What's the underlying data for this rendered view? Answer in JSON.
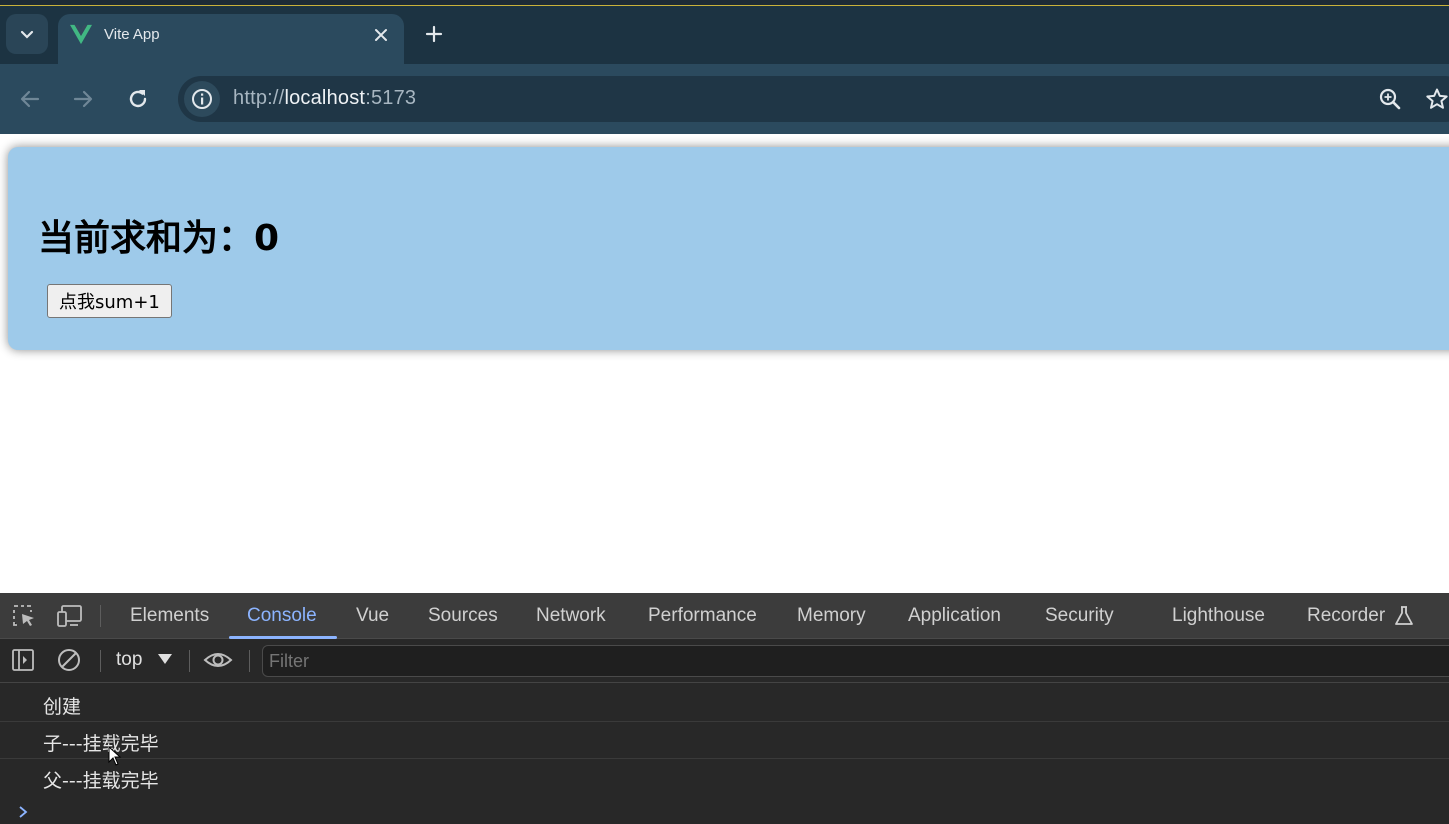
{
  "browser": {
    "tab": {
      "title": "Vite App"
    },
    "url": {
      "protocol": "http://",
      "host": "localhost",
      "port": ":5173"
    }
  },
  "page": {
    "heading": "当前求和为：0",
    "button_label": "点我sum+1"
  },
  "devtools": {
    "tabs": [
      "Elements",
      "Console",
      "Vue",
      "Sources",
      "Network",
      "Performance",
      "Memory",
      "Application",
      "Security",
      "Lighthouse",
      "Recorder"
    ],
    "active_tab": "Console",
    "context": "top",
    "filter_placeholder": "Filter",
    "console_lines": [
      "创建",
      "子---挂载完毕",
      "父---挂载完毕"
    ]
  },
  "colors": {
    "card_background": "#9ecaea",
    "active_tab_accent": "#8cb4ff",
    "browser_chrome": "#2b4a5e"
  }
}
